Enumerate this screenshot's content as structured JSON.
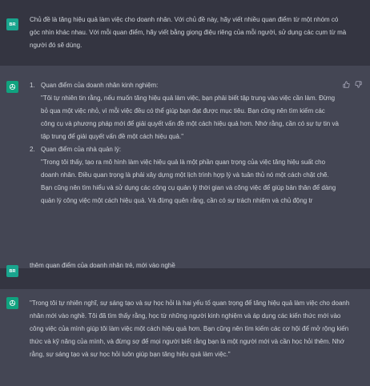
{
  "messages": [
    {
      "role": "user",
      "avatar": "BR",
      "text": "Chủ đề là tăng hiệu quả làm việc cho doanh nhân. Với chủ đề này, hãy viết nhiều quan điểm từ một nhóm có góc nhìn khác nhau. Với mỗi quan điểm, hãy viết bằng giọng điệu riêng của mỗi người, sử dụng các cụm từ mà người đó sẽ dùng."
    },
    {
      "role": "assistant",
      "items": [
        {
          "num": "1.",
          "heading": "Quan điểm của doanh nhân kinh nghiệm:",
          "quote": "\"Tôi tự nhiên tin rằng, nếu muốn tăng hiệu quả làm việc, bạn phải biết tập trung vào việc cần làm. Đừng bỏ qua một việc nhỏ, vì mỗi việc đều có thể giúp bạn đạt được mục tiêu. Bạn cũng nên tìm kiếm các công cụ và phương pháp mới để giải quyết vấn đề một cách hiệu quả hơn. Nhớ rằng, cần có sự tự tin và tập trung để giải quyết vấn đề một cách hiệu quả.\""
        },
        {
          "num": "2.",
          "heading": "Quan điểm của nhà quản lý:",
          "quote": "\"Trong tôi thấy, tạo ra mô hình làm việc hiệu quả là một phần quan trọng của việc tăng hiệu suất cho doanh nhân. Điều quan trọng là phải xây dựng một lịch trình hợp lý và tuân thủ nó một cách chặt chẽ. Bạn cũng nên tìm hiểu và sử dụng các công cụ quản lý thời gian và công việc để giúp bản thân để dàng quản lý công việc một cách hiệu quả. Và đừng quên rằng, cần có sự trách nhiệm và chủ động tr"
        }
      ]
    },
    {
      "role": "user",
      "avatar": "BR",
      "text": "thêm quan điểm của doanh nhân trẻ, mới vào nghề"
    },
    {
      "role": "assistant",
      "text": "\"Trong tôi tự nhiên nghĩ, sự sáng tạo và sự học hỏi là hai yếu tố quan trọng để tăng hiệu quả làm việc cho doanh nhân mới vào nghề. Tôi đã tìm thấy rằng, học từ những người kinh nghiệm và áp dụng các kiến thức mới vào công việc của mình giúp tôi làm việc một cách hiệu quả hơn. Bạn cũng nên tìm kiếm các cơ hội để mở rộng kiến thức và kỹ năng của mình, và đừng sợ để mọi người biết rằng bạn là một người mới và cần học hỏi thêm. Nhớ rằng, sự sáng tạo và sự học hỏi luôn giúp bạn tăng hiệu quả làm việc.\""
    }
  ],
  "icons": [
    "thumbs-up-icon",
    "thumbs-down-icon",
    "openai-logo-icon"
  ],
  "colors": {
    "user_bg": "#343541",
    "assistant_bg": "#444654",
    "text": "#d1d5db",
    "avatar_green": "#10a37f"
  }
}
